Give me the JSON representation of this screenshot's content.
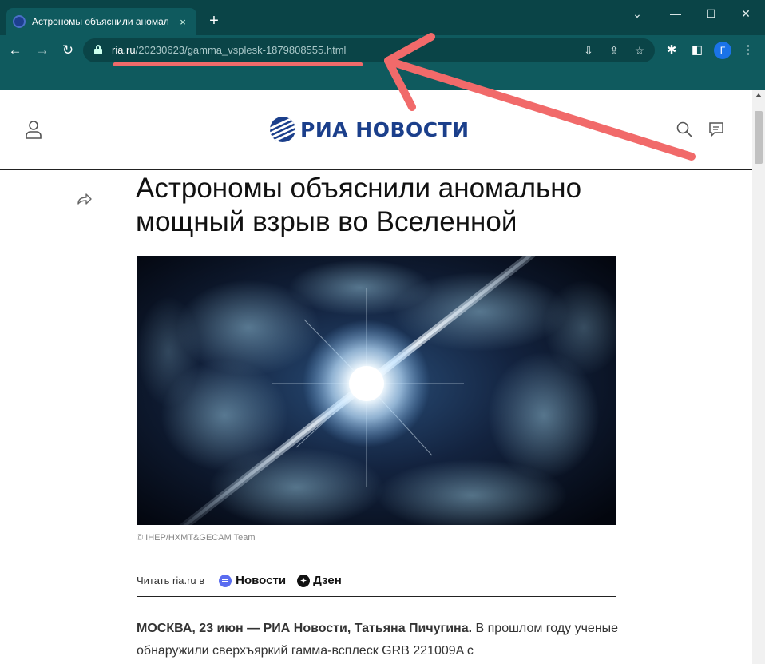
{
  "browser": {
    "tab_title": "Астрономы объяснили аномал",
    "tab_close": "×",
    "new_tab": "+",
    "window": {
      "minimize": "—",
      "maximize": "☐",
      "close": "✕",
      "tabsearch": "⌄"
    },
    "url_host": "ria.ru",
    "url_path": "/20230623/gamma_vsplesk-1879808555.html",
    "profile_initial": "Г"
  },
  "site": {
    "logo_text": "РИА НОВОСТИ"
  },
  "article": {
    "headline": "Астрономы объяснили аномально мощный взрыв во Вселенной",
    "image_credit": "© IHEP/HXMT&GECAM Team",
    "read_label": "Читать ria.ru в",
    "partner_news": "Новости",
    "partner_dzen": "Дзен",
    "lead_bold": "МОСКВА, 23 июн — РИА Новости, Татьяна Пичугина.",
    "lead_text": " В прошлом году ученые обнаружили сверхъяркий гамма-всплеск GRB 221009A с"
  },
  "colors": {
    "chrome": "#0f5a5e",
    "brand": "#1b3f8b",
    "annotation": "#f16a6a"
  }
}
